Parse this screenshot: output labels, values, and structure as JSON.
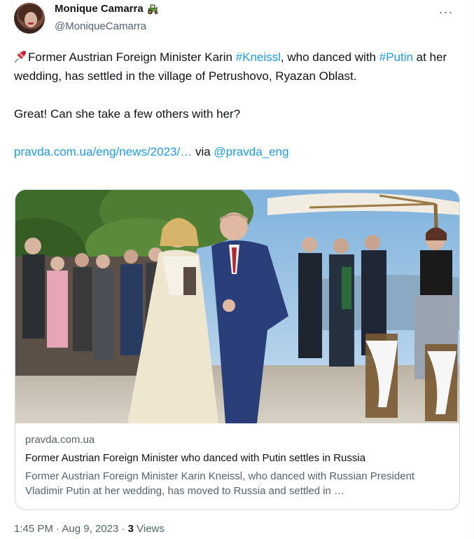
{
  "author": {
    "display_name": "Monique Camarra",
    "name_emoji": "tractor-icon",
    "handle": "@MoniqueCamarra"
  },
  "more_button": {
    "icon": "more-horizontal-icon",
    "glyph": "···"
  },
  "tweet": {
    "pin_emoji": "pushpin-icon",
    "segments_line1": [
      {
        "type": "text",
        "value": "Former Austrian Foreign Minister Karin "
      },
      {
        "type": "hashtag",
        "value": "#Kneissl"
      },
      {
        "type": "text",
        "value": ", who danced with "
      },
      {
        "type": "hashtag",
        "value": "#Putin"
      },
      {
        "type": "text",
        "value": " at her wedding, has settled in the village of Petrushovo, Ryazan Oblast."
      }
    ],
    "line2": "Great! Can she take a few others with her?",
    "link_text": "pravda.com.ua/eng/news/2023/…",
    "via_text": " via ",
    "mention": "@pravda_eng"
  },
  "card": {
    "image_icon": "wedding-dance-photo",
    "domain": "pravda.com.ua",
    "title": "Former Austrian Foreign Minister who danced with Putin settles in Russia",
    "description": "Former Austrian Foreign Minister Karin Kneissl, who danced with Russian President Vladimir Putin at her wedding, has moved to Russia and settled in …"
  },
  "meta": {
    "time": "1:45 PM",
    "sep1": " · ",
    "date": "Aug 9, 2023",
    "sep2": " · ",
    "views_count": "3",
    "views_label": " Views"
  },
  "colors": {
    "link": "#1d9bf0",
    "text": "#0f1419",
    "secondary": "#536471",
    "border": "#cfd9de"
  }
}
